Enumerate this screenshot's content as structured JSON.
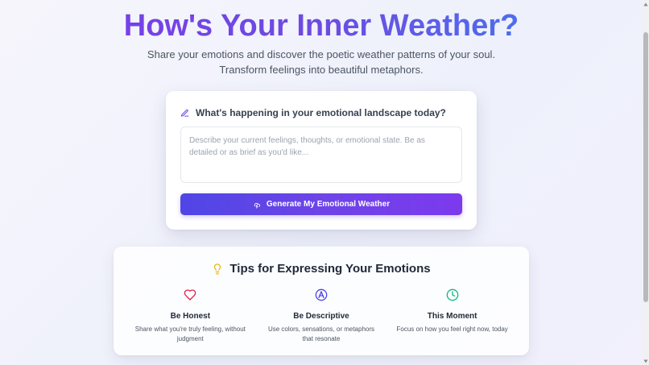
{
  "hero": {
    "title": "How's Your Inner Weather?",
    "subtitle_line1": "Share your emotions and discover the poetic weather patterns of your soul.",
    "subtitle_line2": "Transform feelings into beautiful metaphors."
  },
  "input_card": {
    "prompt_icon": "pencil-icon",
    "prompt": "What's happening in your emotional landscape today?",
    "input_value": "",
    "input_placeholder": "Describe your current feelings, thoughts, or emotional state. Be as detailed or as brief as you'd like...",
    "button_icon": "cloud-lightning-icon",
    "button_label": "Generate My Emotional Weather"
  },
  "tips": {
    "icon": "lightbulb-icon",
    "title": "Tips for Expressing Your Emotions",
    "items": [
      {
        "icon": "heart-icon",
        "title": "Be Honest",
        "description": "Share what you're truly feeling, without judgment",
        "color": "#e11d48"
      },
      {
        "icon": "palette-icon",
        "title": "Be Descriptive",
        "description": "Use colors, sensations, or metaphors that resonate",
        "color": "#4f46e5"
      },
      {
        "icon": "clock-icon",
        "title": "This Moment",
        "description": "Focus on how you feel right now, today",
        "color": "#10b981"
      }
    ]
  },
  "colors": {
    "accent_start": "#4f46e5",
    "accent_end": "#7c3aed",
    "title_gradient_end": "#3b82f6",
    "tip_icon_bulb": "#eab308"
  }
}
